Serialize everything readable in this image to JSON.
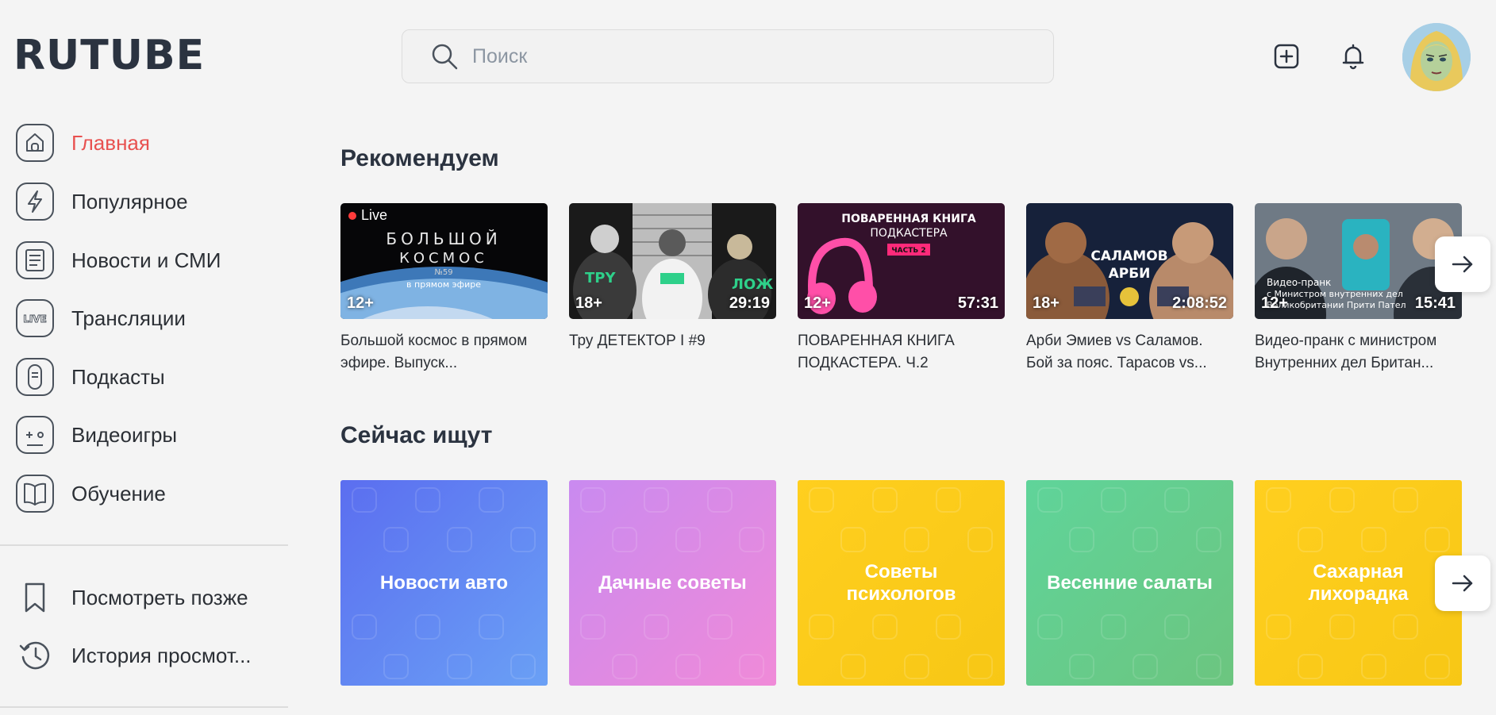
{
  "brand": {
    "logo": "RUTUBE"
  },
  "search": {
    "placeholder": "Поиск"
  },
  "header": {
    "upload_icon": "plus-square-icon",
    "notifications_icon": "bell-icon"
  },
  "sidebar": {
    "items": [
      {
        "label": "Главная",
        "icon": "home-icon",
        "active": true
      },
      {
        "label": "Популярное",
        "icon": "lightning-icon"
      },
      {
        "label": "Новости и СМИ",
        "icon": "newspaper-icon"
      },
      {
        "label": "Трансляции",
        "icon": "live-icon"
      },
      {
        "label": "Подкасты",
        "icon": "microphone-icon"
      },
      {
        "label": "Видеоигры",
        "icon": "gamepad-icon"
      },
      {
        "label": "Обучение",
        "icon": "book-icon"
      }
    ],
    "secondary": [
      {
        "label": "Посмотреть позже",
        "icon": "bookmark-icon"
      },
      {
        "label": "История просмот...",
        "icon": "history-icon"
      }
    ]
  },
  "recommended": {
    "title": "Рекомендуем",
    "videos": [
      {
        "title": "Большой космос в прямом эфире. Выпуск...",
        "age": "12+",
        "duration": "",
        "live": "Live",
        "thumb_text": [
          "БОЛЬШОЙ",
          "КОСМОС",
          "№59",
          "в прямом эфире"
        ]
      },
      {
        "title": "Тру ДЕТЕКТОР I #9",
        "age": "18+",
        "duration": "29:19",
        "live": ""
      },
      {
        "title": "ПОВАРЕННАЯ КНИГА ПОДКАСТЕРА. Ч.2",
        "age": "12+",
        "duration": "57:31",
        "live": "",
        "thumb_text": [
          "ПОВАРЕННАЯ КНИГА",
          "ПОДКАСТЕРА",
          "ЧАСТЬ 2"
        ]
      },
      {
        "title": "Арби Эмиев vs Саламов. Бой за пояс. Тарасов vs...",
        "age": "18+",
        "duration": "2:08:52",
        "live": "",
        "thumb_text": [
          "САЛАМОВ",
          "АРБИ"
        ]
      },
      {
        "title": "Видео-пранк с министром Внутренних дел Британ...",
        "age": "12+",
        "duration": "15:41",
        "live": "",
        "thumb_text": [
          "Видео-пранк",
          "с Министром внутренних дел",
          "Великобритании Прити Пател"
        ]
      }
    ]
  },
  "trending": {
    "title": "Сейчас ищут",
    "tiles": [
      {
        "label": "Новости авто",
        "color_from": "#5b6ef0",
        "color_to": "#6aa0f5"
      },
      {
        "label": "Дачные советы",
        "color_from": "#f08ad8",
        "color_to": "#c98af0"
      },
      {
        "label": "Советы психологов",
        "color_from": "#ffcf1f",
        "color_to": "#f7c715"
      },
      {
        "label": "Весенние салаты",
        "color_from": "#5fd49a",
        "color_to": "#6cc57f"
      },
      {
        "label": "Сахарная лихорадка",
        "color_from": "#ffcf1f",
        "color_to": "#f7c715"
      }
    ]
  },
  "colors": {
    "accent": "#e85150",
    "text": "#2b2f35",
    "background": "#f4f4f4"
  }
}
